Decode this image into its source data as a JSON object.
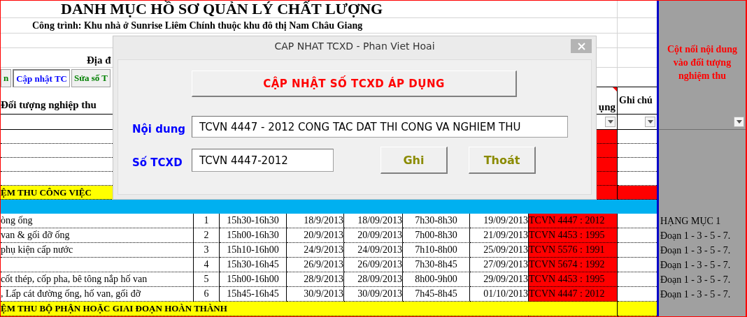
{
  "title": "DANH MỤC HỒ SƠ QUẢN LÝ CHẤT LƯỢNG",
  "project": "Công trình: Khu nhà ở Sunrise Liêm Chính thuộc khu đô thị Nam Châu Giang",
  "location_label": "Địa đ",
  "sheet_buttons": [
    {
      "label": "n",
      "selected": false
    },
    {
      "label": "Cập nhật TC",
      "selected": true
    },
    {
      "label": "Sửa số T",
      "selected": false
    }
  ],
  "headers": {
    "object": "Đối tượng nghiệp thu",
    "standard": "ụng",
    "note": "Ghi chú",
    "connector": "Cột nối nội dung vào đối tượng nghiệm thu"
  },
  "rows": [
    {
      "kind": "blank"
    },
    {
      "kind": "blank"
    },
    {
      "kind": "blank"
    },
    {
      "kind": "blank"
    },
    {
      "kind": "section",
      "label": "ỆM THU CÔNG VIỆC",
      "flagged": true
    },
    {
      "kind": "band"
    },
    {
      "kind": "item",
      "cells": [
        "òng ống",
        "1",
        "15h30-16h30",
        "18/9/2013",
        "18/09/2013",
        "7h30-8h30",
        "19/09/2013",
        "TCVN 4447 : 2012"
      ],
      "connector": "HẠNG MỤC 1"
    },
    {
      "kind": "item",
      "cells": [
        "van & gối đỡ ống",
        "2",
        "15h00-16h30",
        "20/9/2013",
        "20/09/2013",
        "7h00-8h30",
        "21/09/2013",
        "TCVN 4453 : 1995"
      ],
      "connector": "Đoạn 1 - 3 - 5 - 7."
    },
    {
      "kind": "item",
      "cells": [
        "phụ kiện cấp nước",
        "3",
        "15h10-16h00",
        "24/9/2013",
        "24/09/2013",
        "7h10-8h00",
        "25/09/2013",
        "TCVN 5576 : 1991"
      ],
      "connector": "Đoạn 1 - 3 - 5 - 7."
    },
    {
      "kind": "item",
      "cells": [
        "",
        "4",
        "15h30-16h45",
        "26/9/2013",
        "26/09/2013",
        "7h30-8h45",
        "27/09/2013",
        "TCVN 5674 : 1992"
      ],
      "connector": "Đoạn 1 - 3 - 5 - 7."
    },
    {
      "kind": "item",
      "cells": [
        "cốt thép, cốp pha, bê tông nắp hố van",
        "5",
        "15h00-16h00",
        "28/9/2013",
        "28/09/2013",
        "8h00-9h00",
        "29/09/2013",
        "TCVN 4453 : 1995"
      ],
      "connector": "Đoạn 1 - 3 - 5 - 7."
    },
    {
      "kind": "item",
      "cells": [
        ", Lấp cát đường ống, hố van, gối đỡ",
        "6",
        "15h45-16h45",
        "30/9/2013",
        "30/09/2013",
        "7h45-8h45",
        "01/10/2013",
        "TCVN 4447 : 2012"
      ],
      "connector": "Đoạn 1 - 3 - 5 - 7."
    },
    {
      "kind": "section",
      "label": "ỆM THU BỘ PHẬN HOẶC GIAI ĐOẠN HOÀN THÀNH",
      "flagged": false
    }
  ],
  "dialog": {
    "title": "CAP NHAT TCXD - Phan Viet Hoai",
    "header_button": "CẬP NHẬT SỐ TCXD ÁP DỤNG",
    "fields": [
      {
        "label": "Nội dung",
        "value": "TCVN 4447 - 2012 CONG TAC DAT THI CONG VA NGHIEM THU"
      },
      {
        "label": "Số TCXD",
        "value": "TCVN 4447-2012"
      }
    ],
    "buttons": [
      "Ghi",
      "Thoát"
    ]
  }
}
